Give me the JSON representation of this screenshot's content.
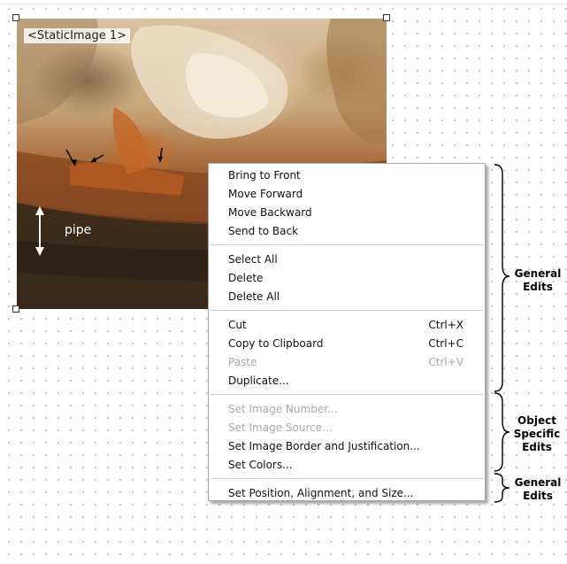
{
  "image": {
    "label": "<StaticImage 1>",
    "pipe_label": "pipe"
  },
  "menu": {
    "groups": [
      {
        "items": [
          {
            "label": "Bring to Front",
            "shortcut": "",
            "enabled": true
          },
          {
            "label": "Move Forward",
            "shortcut": "",
            "enabled": true
          },
          {
            "label": "Move Backward",
            "shortcut": "",
            "enabled": true
          },
          {
            "label": "Send to Back",
            "shortcut": "",
            "enabled": true
          }
        ]
      },
      {
        "items": [
          {
            "label": "Select All",
            "shortcut": "",
            "enabled": true
          },
          {
            "label": "Delete",
            "shortcut": "",
            "enabled": true
          },
          {
            "label": "Delete All",
            "shortcut": "",
            "enabled": true
          }
        ]
      },
      {
        "items": [
          {
            "label": "Cut",
            "shortcut": "Ctrl+X",
            "enabled": true
          },
          {
            "label": "Copy to Clipboard",
            "shortcut": "Ctrl+C",
            "enabled": true
          },
          {
            "label": "Paste",
            "shortcut": "Ctrl+V",
            "enabled": false
          },
          {
            "label": "Duplicate...",
            "shortcut": "",
            "enabled": true
          }
        ]
      },
      {
        "items": [
          {
            "label": "Set Image Number...",
            "shortcut": "",
            "enabled": false
          },
          {
            "label": "Set Image Source...",
            "shortcut": "",
            "enabled": false
          },
          {
            "label": "Set Image Border and Justification...",
            "shortcut": "",
            "enabled": true
          },
          {
            "label": "Set Colors...",
            "shortcut": "",
            "enabled": true
          }
        ]
      },
      {
        "items": [
          {
            "label": "Set Position, Alignment, and Size...",
            "shortcut": "",
            "enabled": true
          }
        ]
      }
    ]
  },
  "annotations": {
    "general_edits_1": [
      "General",
      "Edits"
    ],
    "object_specific_edits": [
      "Object",
      "Specific",
      "Edits"
    ],
    "general_edits_2": [
      "General",
      "Edits"
    ]
  }
}
